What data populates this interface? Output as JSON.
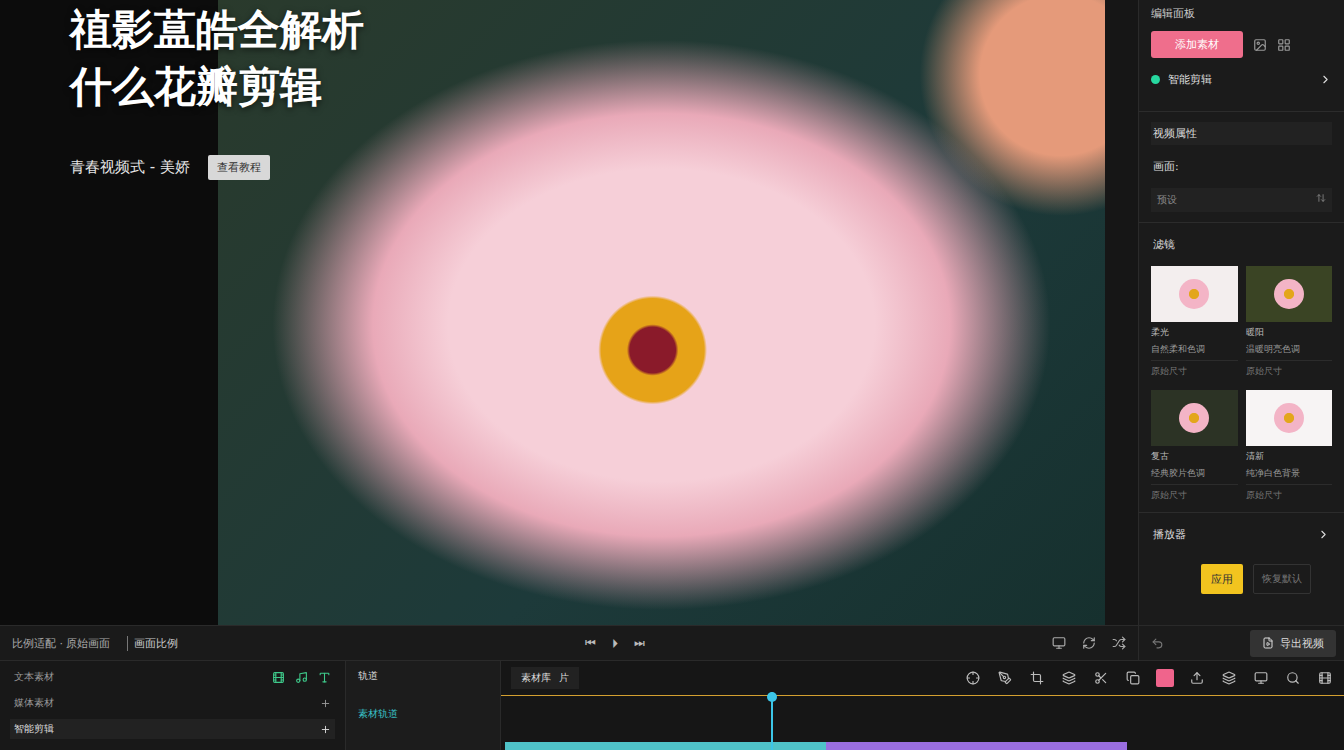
{
  "overlay": {
    "title_lines": [
      "禃影蒀皓全解析",
      "什么花瓣剪辑"
    ],
    "subtitle": "青春视频式 - 美娇",
    "tag": "查看教程"
  },
  "preview_bar": {
    "left": "比例适配 · 原始画面",
    "label": "画面比例",
    "controls": [
      "⏮",
      "⏵",
      "⏭"
    ]
  },
  "panel": {
    "title": "编辑面板",
    "primary_button": "添加素材",
    "smart_item": "智能剪辑",
    "section": "视频属性",
    "label": "画面:",
    "input": "预设",
    "filter_title": "滤镜",
    "filters": [
      {
        "name": "柔光",
        "desc": "自然柔和色调",
        "meta": "原始尺寸",
        "color": "#f3eeee"
      },
      {
        "name": "暖阳",
        "desc": "温暖明亮色调",
        "meta": "原始尺寸",
        "color": "#3a4424"
      },
      {
        "name": "复古",
        "desc": "经典胶片色调",
        "meta": "原始尺寸",
        "color": "#2c3325"
      },
      {
        "name": "清新",
        "desc": "纯净白色背景",
        "meta": "原始尺寸",
        "color": "#f7f4f4"
      }
    ],
    "player_title": "播放器",
    "apply": "应用",
    "cancel": "恢复默认",
    "export": "导出视频"
  },
  "timeline": {
    "left_title": "文本素材",
    "rows": [
      {
        "label": "媒体素材",
        "selected": false
      },
      {
        "label": "智能剪辑",
        "selected": true
      }
    ],
    "mid_title": "轨道",
    "mid_item": "素材轨道",
    "tab": "素材库",
    "tab_badge": "片",
    "tools": [
      {
        "selected": false
      },
      {
        "selected": false
      },
      {
        "selected": false
      },
      {
        "selected": false
      },
      {
        "selected": false
      },
      {
        "selected": false
      },
      {
        "selected": true
      },
      {
        "selected": false
      },
      {
        "selected": false
      },
      {
        "selected": false
      },
      {
        "selected": false
      },
      {
        "selected": false
      }
    ],
    "playhead": {
      "level": 0.32
    },
    "clips": [
      {
        "level": 0.385,
        "color": "#4fc3c8"
      },
      {
        "level": 0.36,
        "color": "#9a6ee0"
      }
    ]
  }
}
